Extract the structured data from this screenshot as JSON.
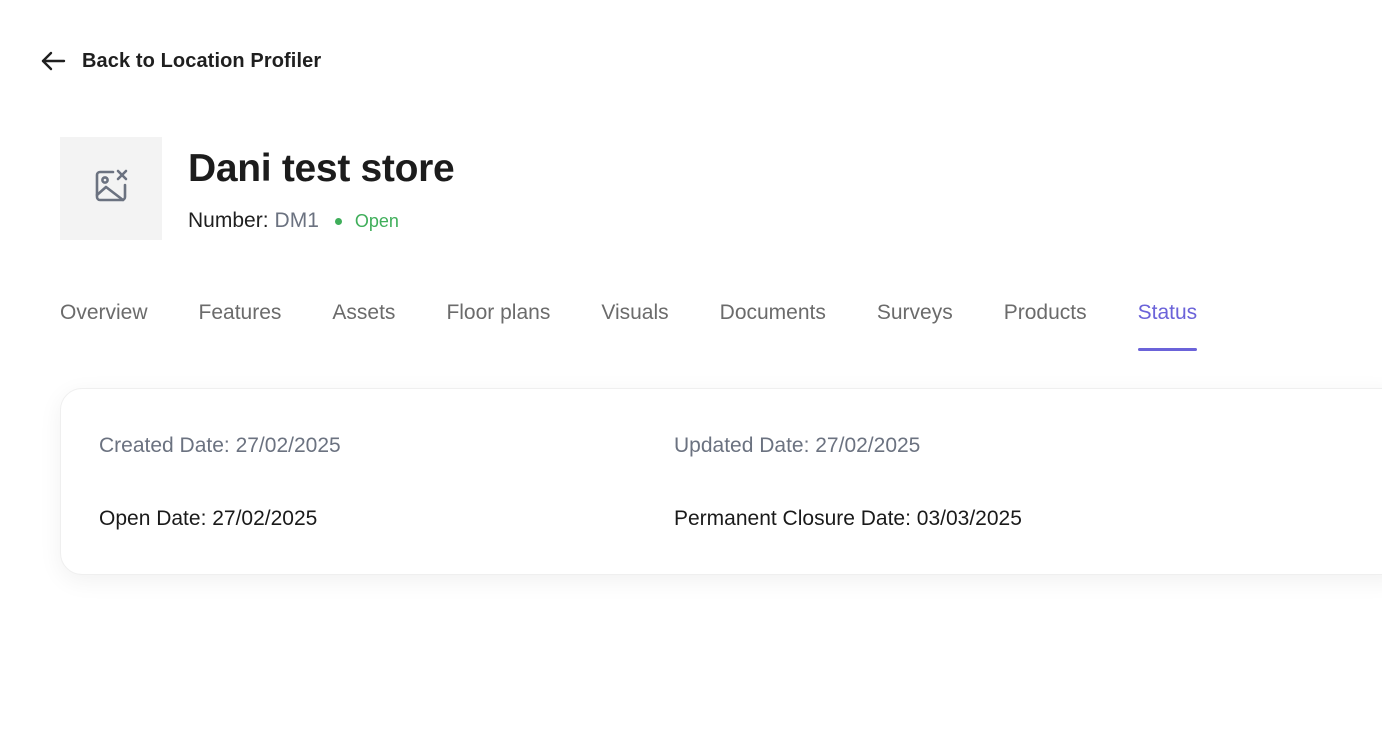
{
  "back_link": {
    "label": "Back to Location Profiler",
    "icon": "arrow-left-icon"
  },
  "store": {
    "image_icon": "image-off-icon",
    "title": "Dani test store",
    "number_label": "Number:",
    "number_value": "DM1",
    "status": "Open",
    "status_color": "#3fae5a"
  },
  "tabs": [
    {
      "label": "Overview",
      "active": false
    },
    {
      "label": "Features",
      "active": false
    },
    {
      "label": "Assets",
      "active": false
    },
    {
      "label": "Floor plans",
      "active": false
    },
    {
      "label": "Visuals",
      "active": false
    },
    {
      "label": "Documents",
      "active": false
    },
    {
      "label": "Surveys",
      "active": false
    },
    {
      "label": "Products",
      "active": false
    },
    {
      "label": "Status",
      "active": true
    }
  ],
  "accent_color": "#6b63d9",
  "status_card": {
    "created": "Created Date: 27/02/2025",
    "updated": "Updated Date: 27/02/2025",
    "open": "Open Date: 27/02/2025",
    "closure": "Permanent Closure Date: 03/03/2025"
  }
}
